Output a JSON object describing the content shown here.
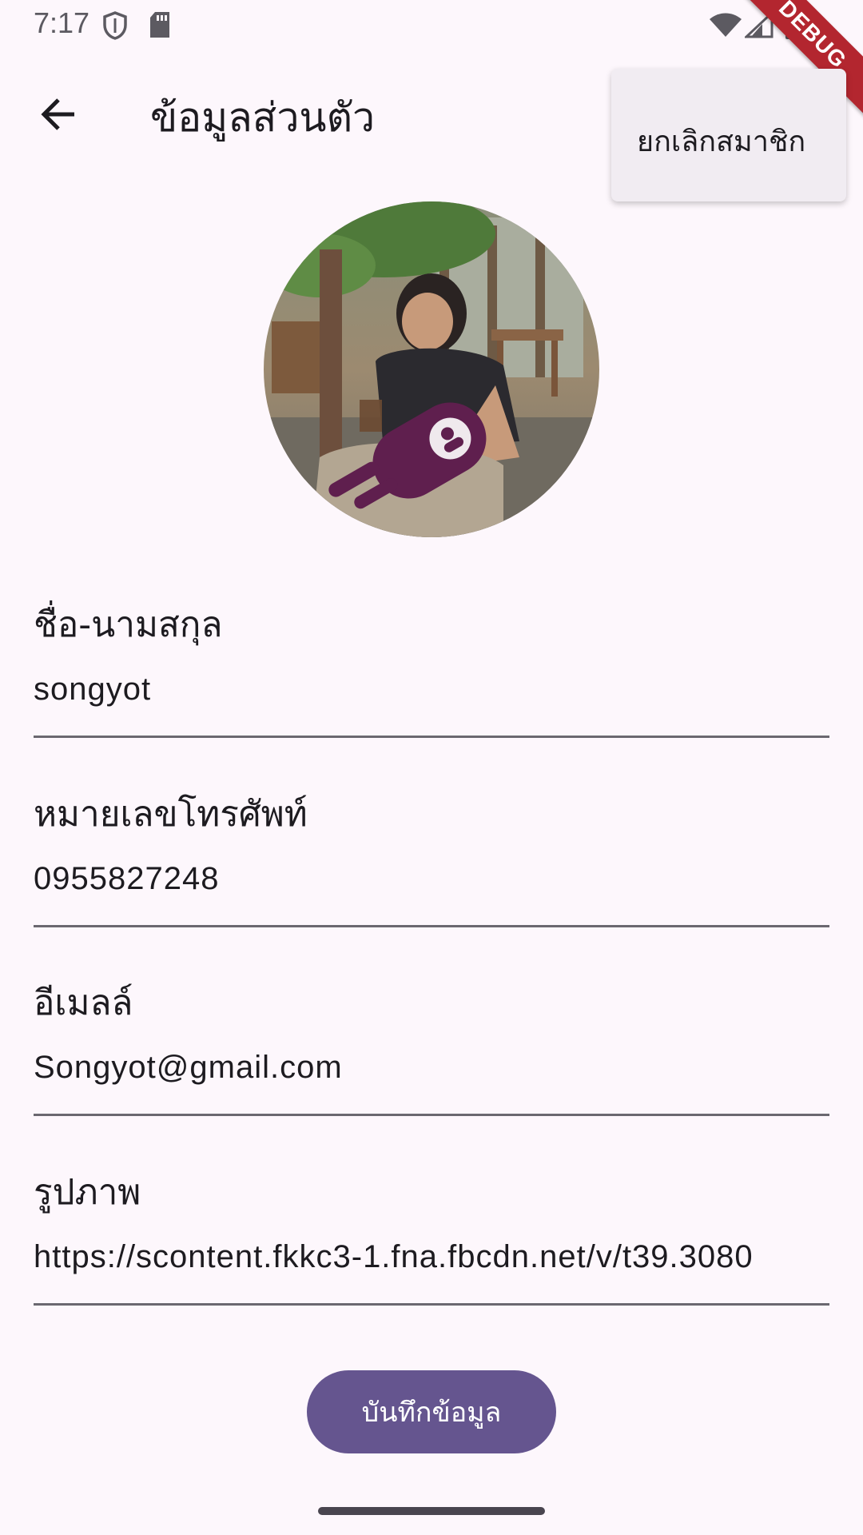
{
  "status_bar": {
    "time": "7:17",
    "icons": [
      "shield-icon",
      "sd-card-icon",
      "wifi-icon",
      "signal-icon",
      "battery-icon"
    ],
    "debug_banner": "DEBUG"
  },
  "app_bar": {
    "title": "ข้อมูลส่วนตัว",
    "back_icon": "arrow-back-icon"
  },
  "menu": {
    "items": [
      {
        "label": "ยกเลิกสมาชิก"
      }
    ]
  },
  "profile": {
    "avatar": "profile-photo"
  },
  "form": {
    "fields": [
      {
        "label": "ชื่อ-นามสกุล",
        "value": "songyot"
      },
      {
        "label": "หมายเลขโทรศัพท์",
        "value": "0955827248"
      },
      {
        "label": "อีเมลล์",
        "value": "Songyot@gmail.com"
      },
      {
        "label": "รูปภาพ",
        "value": "https://scontent.fkkc3-1.fna.fbcdn.net/v/t39.3080"
      }
    ],
    "save_label": "บันทึกข้อมูล"
  },
  "colors": {
    "background": "#fdf7fc",
    "primary": "#65558f",
    "menu_surface": "#f1ecf2",
    "debug_ribbon": "#b3262f"
  }
}
